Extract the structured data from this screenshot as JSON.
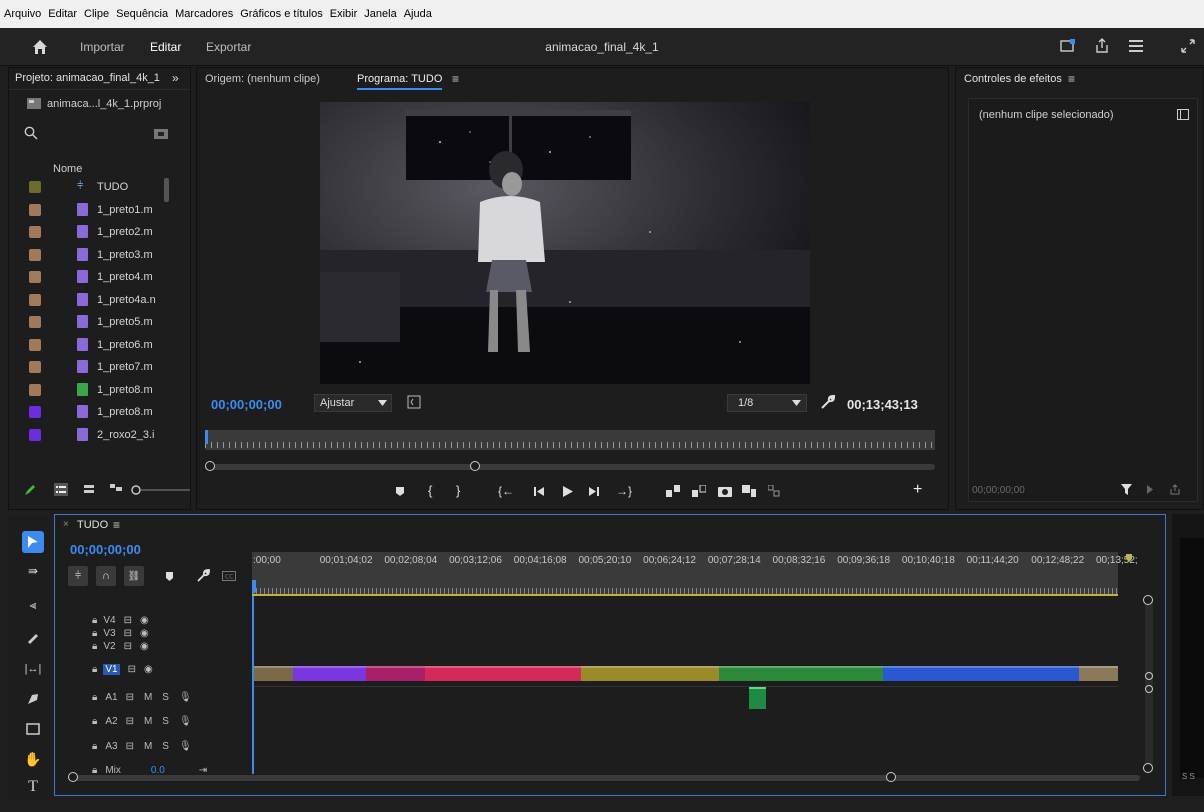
{
  "menu": [
    "Arquivo",
    "Editar",
    "Clipe",
    "Sequência",
    "Marcadores",
    "Gráficos e títulos",
    "Exibir",
    "Janela",
    "Ajuda"
  ],
  "header": {
    "home_icon": "home-icon",
    "tabs": [
      "Importar",
      "Editar",
      "Exportar"
    ],
    "active_tab": "Editar",
    "title": "animacao_final_4k_1"
  },
  "project": {
    "tab_label": "Projeto: animacao_final_4k_1",
    "expand": "»",
    "file": "animaca...l_4k_1.prproj",
    "column_name": "Nome",
    "items": [
      {
        "name": "TUDO",
        "label_color": "#6b6b2a",
        "icon": "sequence"
      },
      {
        "name": "1_preto1.m",
        "label_color": "#a07a5a",
        "icon": "clip"
      },
      {
        "name": "1_preto2.m",
        "label_color": "#a07a5a",
        "icon": "clip"
      },
      {
        "name": "1_preto3.m",
        "label_color": "#a07a5a",
        "icon": "clip"
      },
      {
        "name": "1_preto4.m",
        "label_color": "#a07a5a",
        "icon": "clip"
      },
      {
        "name": "1_preto4a.n",
        "label_color": "#a07a5a",
        "icon": "clip"
      },
      {
        "name": "1_preto5.m",
        "label_color": "#a07a5a",
        "icon": "clip"
      },
      {
        "name": "1_preto6.m",
        "label_color": "#a07a5a",
        "icon": "clip"
      },
      {
        "name": "1_preto7.m",
        "label_color": "#a07a5a",
        "icon": "clip"
      },
      {
        "name": "1_preto8.m",
        "label_color": "#a07a5a",
        "icon": "sequence-green"
      },
      {
        "name": "1_preto8.m",
        "label_color": "#6a2ee0",
        "icon": "clip"
      },
      {
        "name": "2_roxo2_3.i",
        "label_color": "#6a2ee0",
        "icon": "clip"
      }
    ]
  },
  "monitor": {
    "source_tab": "Origem: (nenhum clipe)",
    "program_tab": "Programa: TUDO",
    "timecode_current": "00;00;00;00",
    "fit": "Ajustar",
    "resolution": "1/8",
    "timecode_duration": "00;13;43;13"
  },
  "effects": {
    "tab_label": "Controles de efeitos",
    "no_clip": "(nenhum clipe selecionado)",
    "timecode": "00;00;00;00"
  },
  "timeline": {
    "tab_label": "TUDO",
    "timecode": "00;00;00;00",
    "ruler": [
      ":00;00",
      "00;01;04;02",
      "00;02;08;04",
      "00;03;12;06",
      "00;04;16;08",
      "00;05;20;10",
      "00;06;24;12",
      "00;07;28;14",
      "00;08;32;16",
      "00;09;36;18",
      "00;10;40;18",
      "00;11;44;20",
      "00;12;48;22",
      "00;13;52;"
    ],
    "video_tracks": [
      "V4",
      "V3",
      "V2",
      "V1"
    ],
    "audio_tracks": [
      "A1",
      "A2",
      "A3"
    ],
    "audio_m": "M",
    "audio_s": "S",
    "mix_label": "Mix",
    "mix_value": "0.0",
    "clips": [
      {
        "color": "#7a6a4a",
        "start": 0.0,
        "end": 0.045
      },
      {
        "color": "#7a36e0",
        "start": 0.045,
        "end": 0.13
      },
      {
        "color": "#a8206a",
        "start": 0.13,
        "end": 0.198
      },
      {
        "color": "#d42a5a",
        "start": 0.198,
        "end": 0.378
      },
      {
        "color": "#9a8a2a",
        "start": 0.378,
        "end": 0.538
      },
      {
        "color": "#2a8a3a",
        "start": 0.538,
        "end": 0.728
      },
      {
        "color": "#2a58d0",
        "start": 0.728,
        "end": 0.955
      },
      {
        "color": "#8a7a5a",
        "start": 0.955,
        "end": 1.0
      }
    ],
    "audio_clip": {
      "color": "#1f8a45",
      "start": 0.573,
      "end": 0.593
    },
    "meter_label": "S S"
  },
  "colors": {
    "accent": "#3c8cf0",
    "panel_bg": "#1d1d1d",
    "header_bg": "#232323"
  }
}
